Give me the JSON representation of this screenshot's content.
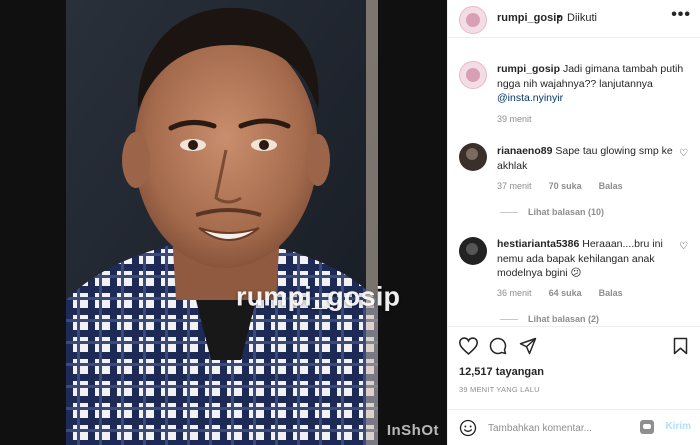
{
  "media": {
    "watermark": "rumpi_gosip",
    "corner_mark": "InShOt"
  },
  "header": {
    "username": "rumpi_gosip",
    "separator": "•",
    "follow_status": "Diikuti",
    "more_icon": "more-horizontal-icon"
  },
  "caption": {
    "username": "rumpi_gosip",
    "text": "Jadi gimana tambah putih ngga nih wajahnya?? lanjutannya",
    "mention": "@insta.nyinyir",
    "time": "39 menit"
  },
  "comments": [
    {
      "username": "rianaeno89",
      "text": "Sape tau glowing smp ke akhlak",
      "time": "37 menit",
      "likes": "70 suka",
      "reply_label": "Balas",
      "view_replies": "Lihat balasan (10)"
    },
    {
      "username": "hestiarianta5386",
      "text": "Heraaan....bru ini nemu ada bapak kehilangan anak modelnya bgini 😕",
      "time": "36 menit",
      "likes": "64 suka",
      "reply_label": "Balas",
      "view_replies": "Lihat balasan (2)"
    }
  ],
  "actions": {
    "icons": [
      "heart-icon",
      "comment-icon",
      "share-icon",
      "bookmark-icon"
    ],
    "views": "12,517 tayangan",
    "posted": "39 MENIT YANG LALU"
  },
  "add_comment": {
    "placeholder": "Tambahkan komentar...",
    "send_label": "Kirim"
  },
  "colors": {
    "text": "#262626",
    "muted": "#8e8e8e",
    "link": "#00376b",
    "send_disabled": "#b2dffc",
    "divider": "#efefef"
  }
}
